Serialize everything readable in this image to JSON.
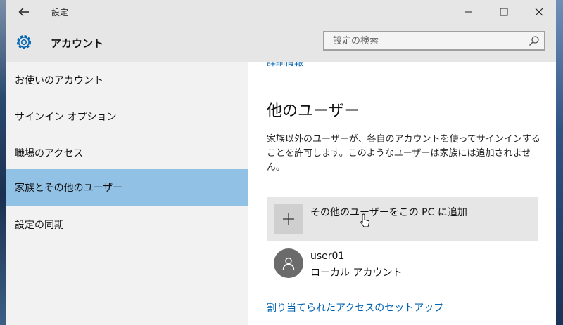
{
  "window": {
    "title": "設定",
    "back_icon": "back-arrow-icon",
    "minimize_icon": "minimize-icon",
    "maximize_icon": "maximize-icon",
    "close_icon": "close-icon"
  },
  "header": {
    "icon": "gear-icon",
    "title": "アカウント",
    "search_placeholder": "設定の検索",
    "search_icon": "search-icon"
  },
  "sidebar": {
    "items": [
      {
        "label": "お使いのアカウント",
        "selected": false
      },
      {
        "label": "サインイン オプション",
        "selected": false
      },
      {
        "label": "職場のアクセス",
        "selected": false
      },
      {
        "label": "家族とその他のユーザー",
        "selected": true
      },
      {
        "label": "設定の同期",
        "selected": false
      }
    ]
  },
  "main": {
    "partial_link": "詳細情報",
    "section_title": "他のユーザー",
    "description": "家族以外のユーザーが、各自のアカウントを使ってサインインすることを許可します。このようなユーザーは家族には追加されません。",
    "add_user_label": "その他のユーザーをこの PC に追加",
    "users": [
      {
        "name": "user01",
        "type": "ローカル アカウント"
      }
    ],
    "assigned_access_link": "割り当てられたアクセスのセットアップ"
  },
  "colors": {
    "accent_selection": "#92c1e6",
    "link": "#0063b1",
    "chrome": "#e6e6e6",
    "sidebar": "#f2f2f2"
  }
}
